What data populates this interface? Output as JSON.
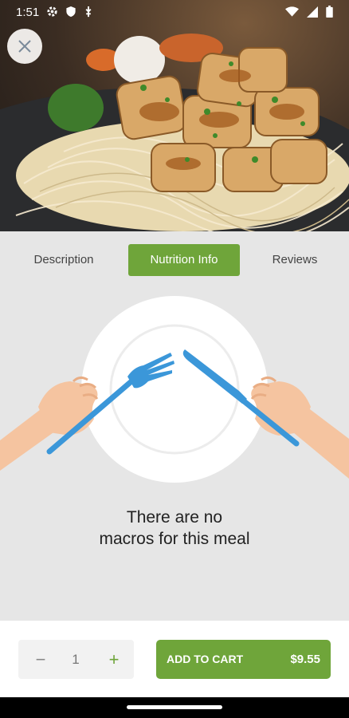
{
  "status_bar": {
    "time": "1:51"
  },
  "tabs": [
    {
      "label": "Description"
    },
    {
      "label": "Nutrition Info",
      "active": true
    },
    {
      "label": "Reviews"
    }
  ],
  "empty_state": {
    "line1": "There are no",
    "line2": "macros for this meal"
  },
  "cart": {
    "quantity": "1",
    "minus": "−",
    "plus": "+",
    "add_label": "ADD TO CART",
    "price": "$9.55"
  },
  "colors": {
    "accent": "#6fa53a",
    "panel_bg": "#e6e6e6",
    "cutlery": "#3b97d9",
    "skin": "#f5c4a0"
  },
  "icons": {
    "close": "close-icon",
    "settings": "gear-icon",
    "shield": "shield-icon",
    "usb": "usb-icon",
    "wifi": "wifi-icon",
    "signal": "signal-icon",
    "battery": "battery-icon"
  }
}
